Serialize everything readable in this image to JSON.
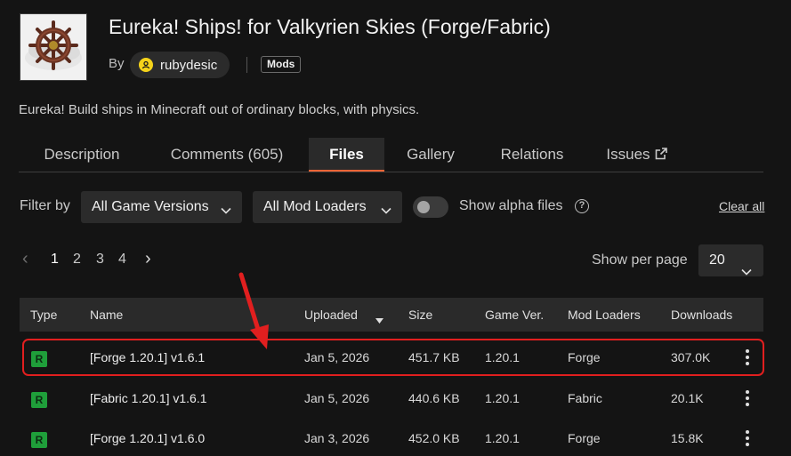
{
  "project": {
    "title": "Eureka! Ships! for Valkyrien Skies (Forge/Fabric)",
    "by_label": "By",
    "author": "rubydesic",
    "category_badge": "Mods",
    "summary": "Eureka! Build ships in Minecraft out of ordinary blocks, with physics."
  },
  "tabs": [
    {
      "label": "Description",
      "active": false
    },
    {
      "label": "Comments (605)",
      "active": false
    },
    {
      "label": "Files",
      "active": true
    },
    {
      "label": "Gallery",
      "active": false
    },
    {
      "label": "Relations",
      "active": false
    },
    {
      "label": "Issues",
      "active": false,
      "external": true
    }
  ],
  "filters": {
    "label": "Filter by",
    "game_versions": "All Game Versions",
    "mod_loaders": "All Mod Loaders",
    "alpha_toggle_label": "Show alpha files",
    "alpha_enabled": false,
    "clear_all": "Clear all"
  },
  "pagination": {
    "prev_symbol": "‹",
    "pages": [
      "1",
      "2",
      "3",
      "4"
    ],
    "current_page": "1",
    "next_symbol": "›",
    "per_page_label": "Show per page",
    "per_page_value": "20"
  },
  "table": {
    "headers": {
      "type": "Type",
      "name": "Name",
      "uploaded": "Uploaded",
      "size": "Size",
      "game_ver": "Game Ver.",
      "mod_loaders": "Mod Loaders",
      "downloads": "Downloads"
    },
    "sorted_column": "uploaded",
    "rows": [
      {
        "type": "R",
        "name": "[Forge 1.20.1] v1.6.1",
        "uploaded": "Jan 5, 2026",
        "size": "451.7 KB",
        "game_ver": "1.20.1",
        "loader": "Forge",
        "downloads": "307.0K",
        "highlighted": true
      },
      {
        "type": "R",
        "name": "[Fabric 1.20.1] v1.6.1",
        "uploaded": "Jan 5, 2026",
        "size": "440.6 KB",
        "game_ver": "1.20.1",
        "loader": "Fabric",
        "downloads": "20.1K",
        "highlighted": false
      },
      {
        "type": "R",
        "name": "[Forge 1.20.1] v1.6.0",
        "uploaded": "Jan 3, 2026",
        "size": "452.0 KB",
        "game_ver": "1.20.1",
        "loader": "Forge",
        "downloads": "15.8K",
        "highlighted": false
      }
    ]
  },
  "colors": {
    "background": "#141414",
    "accent_tab": "#f16436",
    "release_badge": "#1f9e3a",
    "annotation_red": "#e11f1f",
    "author_avatar": "#f5d31a"
  },
  "icons": {
    "logo": "ship-wheel-logo",
    "author_avatar": "user-icon",
    "issues_external": "external-link-icon",
    "dropdown": "chevron-down-icon",
    "help": "question-circle-icon",
    "row_menu": "kebab-menu-icon",
    "sort": "sort-down-icon"
  }
}
